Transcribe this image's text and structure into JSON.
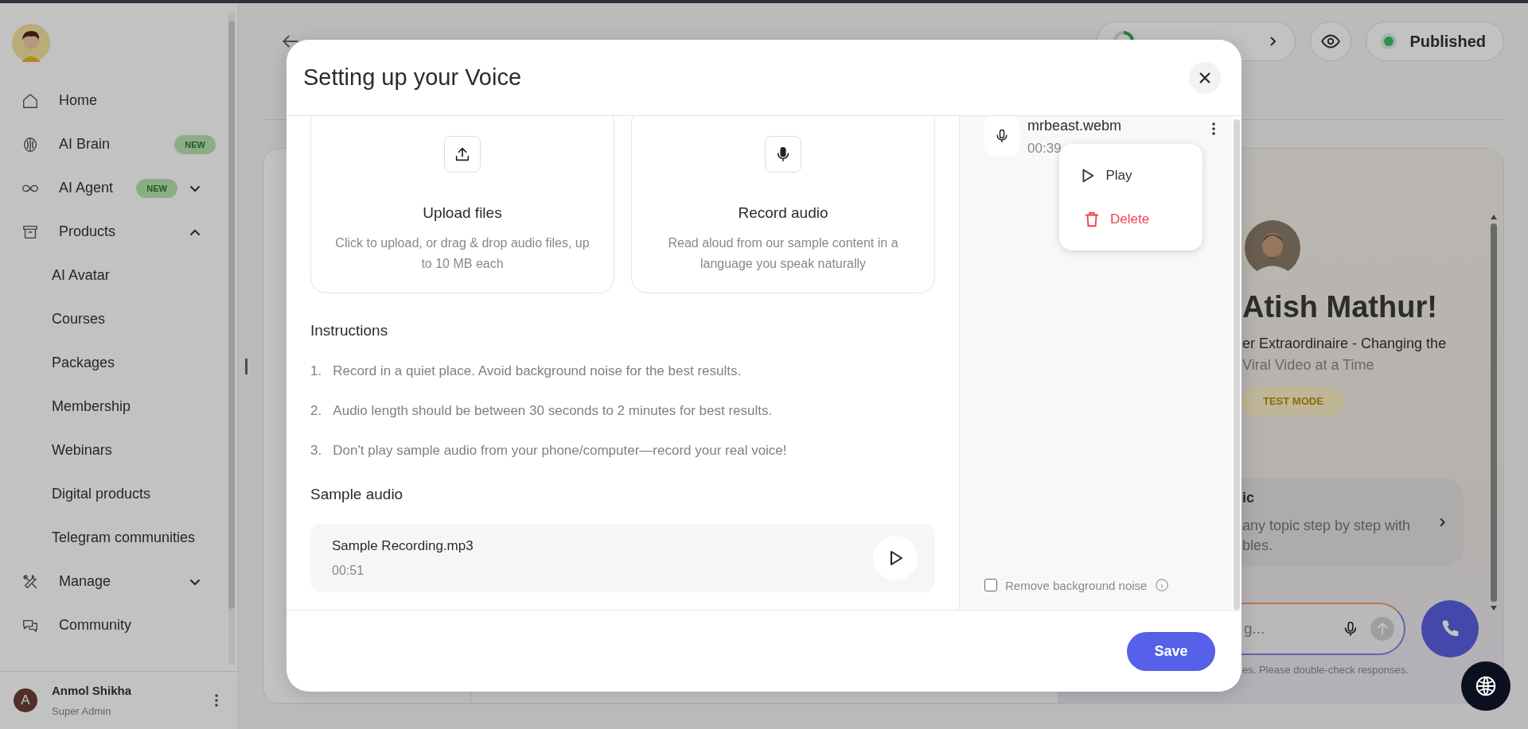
{
  "sidebar": {
    "items": [
      {
        "label": "Home"
      },
      {
        "label": "AI Brain",
        "badge": "NEW"
      },
      {
        "label": "AI Agent",
        "badge": "NEW",
        "expanded": false
      },
      {
        "label": "Products",
        "expanded": true,
        "children": [
          {
            "label": "AI Avatar"
          },
          {
            "label": "Courses"
          },
          {
            "label": "Packages"
          },
          {
            "label": "Membership"
          },
          {
            "label": "Webinars"
          },
          {
            "label": "Digital products"
          },
          {
            "label": "Telegram communities"
          }
        ]
      },
      {
        "label": "Manage",
        "expanded": false
      },
      {
        "label": "Community"
      }
    ],
    "user": {
      "initial": "A",
      "name": "Anmol Shikha",
      "role": "Super Admin"
    }
  },
  "header": {
    "status": "Published"
  },
  "preview": {
    "name": "Atish Mathur!",
    "tagline": [
      "er Extraordinaire - Changing the",
      "Viral Video at a Time"
    ],
    "badge": "TEST MODE",
    "suggestion": {
      "title": "ic",
      "lines": [
        "any topic step by step with",
        "bles."
      ]
    },
    "input_placeholder": "g...",
    "disclaimer": "es. Please double-check responses."
  },
  "modal": {
    "title": "Setting up your Voice",
    "options": [
      {
        "kind": "upload",
        "title": "Upload files",
        "description": "Click to upload, or drag & drop audio files, up to 10 MB each"
      },
      {
        "kind": "record",
        "title": "Record audio",
        "description": "Read aloud from our sample content in a language you speak naturally"
      }
    ],
    "instructions_heading": "Instructions",
    "instructions": [
      {
        "number": "1.",
        "text": "Record in a quiet place. Avoid background noise for the best results."
      },
      {
        "number": "2.",
        "text": "Audio length should be between 30 seconds to 2 minutes for best results."
      },
      {
        "number": "3.",
        "text": "Don't play sample audio from your phone/computer—record your real voice!"
      }
    ],
    "sample_heading": "Sample audio",
    "sample": {
      "file": "Sample Recording.mp3",
      "duration": "00:51"
    },
    "recordings": [
      {
        "file": "mrbeast.webm",
        "duration": "00:39"
      }
    ],
    "menu": [
      {
        "kind": "play",
        "label": "Play"
      },
      {
        "kind": "delete",
        "label": "Delete"
      }
    ],
    "noise_option": {
      "label": "Remove background noise",
      "checked": false
    },
    "save": "Save"
  }
}
